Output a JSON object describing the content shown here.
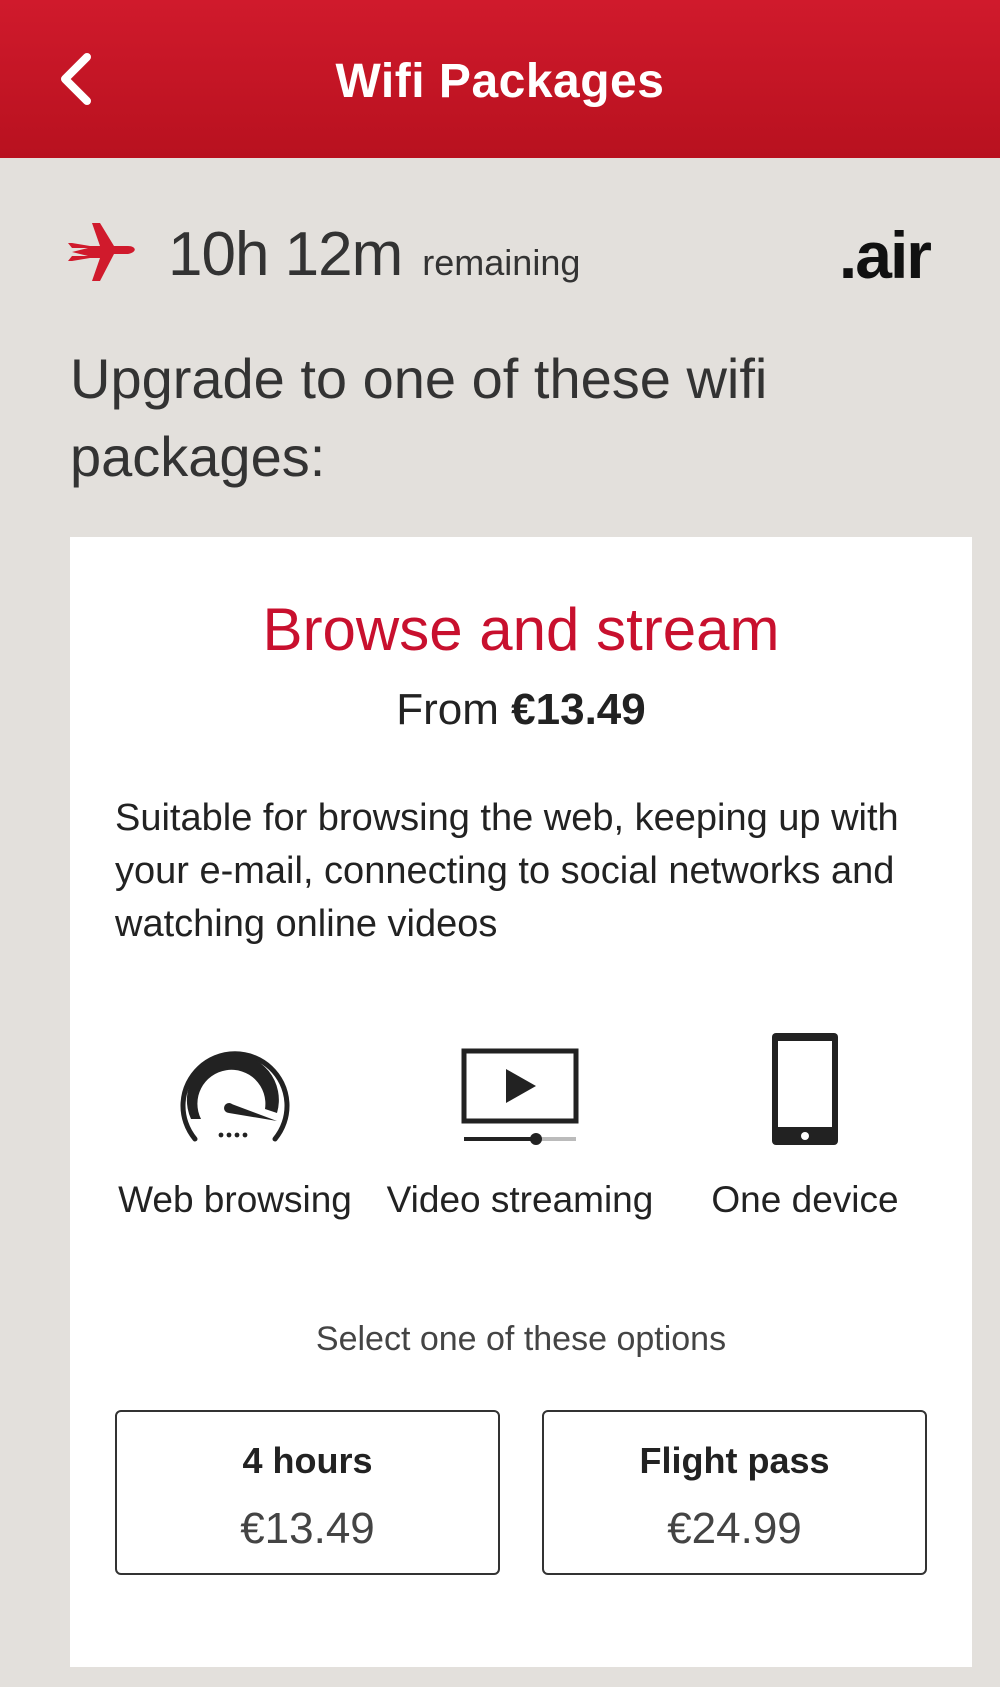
{
  "header": {
    "title": "Wifi Packages",
    "back_icon": "chevron-left-icon"
  },
  "status": {
    "plane_icon": "airplane-icon",
    "time_value": "10h 12m",
    "time_label": "remaining",
    "brand": ".air"
  },
  "intro": {
    "text": "Upgrade to one of these wifi packages:"
  },
  "package": {
    "name": "Browse and stream",
    "price_prefix": "From",
    "price": "€13.49",
    "description": "Suitable for browsing the web, keeping up with your e-mail, connecting to social networks and watching online videos",
    "features": [
      {
        "label": "Web browsing",
        "icon": "speedometer-icon"
      },
      {
        "label": "Video streaming",
        "icon": "video-player-icon"
      },
      {
        "label": "One device",
        "icon": "smartphone-icon"
      }
    ],
    "select_prompt": "Select one of these options",
    "options": [
      {
        "title": "4 hours",
        "price": "€13.49"
      },
      {
        "title": "Flight pass",
        "price": "€24.99"
      }
    ]
  },
  "colors": {
    "header_red": "#c8102e",
    "accent_red": "#c8102e",
    "background": "#e3e0dc",
    "card": "#ffffff"
  }
}
